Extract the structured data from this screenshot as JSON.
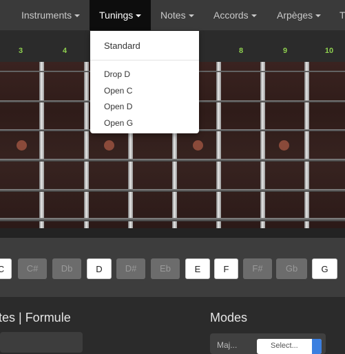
{
  "nav": {
    "items": [
      {
        "label": "Instruments"
      },
      {
        "label": "Tunings"
      },
      {
        "label": "Notes"
      },
      {
        "label": "Accords"
      },
      {
        "label": "Arpèges"
      },
      {
        "label": "T"
      }
    ]
  },
  "fret_numbers": [
    "3",
    "4",
    "8",
    "9",
    "10"
  ],
  "tunings_menu": {
    "items": [
      "Standard",
      "Drop D",
      "Open C",
      "Open D",
      "Open G"
    ]
  },
  "notes": [
    {
      "label": "C",
      "active": true
    },
    {
      "label": "C#",
      "active": false
    },
    {
      "label": "Db",
      "active": false
    },
    {
      "label": "D",
      "active": true
    },
    {
      "label": "D#",
      "active": false
    },
    {
      "label": "Eb",
      "active": false
    },
    {
      "label": "E",
      "active": true
    },
    {
      "label": "F",
      "active": true
    },
    {
      "label": "F#",
      "active": false
    },
    {
      "label": "Gb",
      "active": false
    },
    {
      "label": "G",
      "active": true
    }
  ],
  "sections": {
    "left_title": "tes | Formule",
    "right_title": "Modes",
    "modes_label": "Maj...",
    "modes_select": "Select..."
  },
  "colors": {
    "fret_number": "#8fd14f",
    "active_nav": "#0d0d0d",
    "select_accent": "#3b7fe0"
  }
}
